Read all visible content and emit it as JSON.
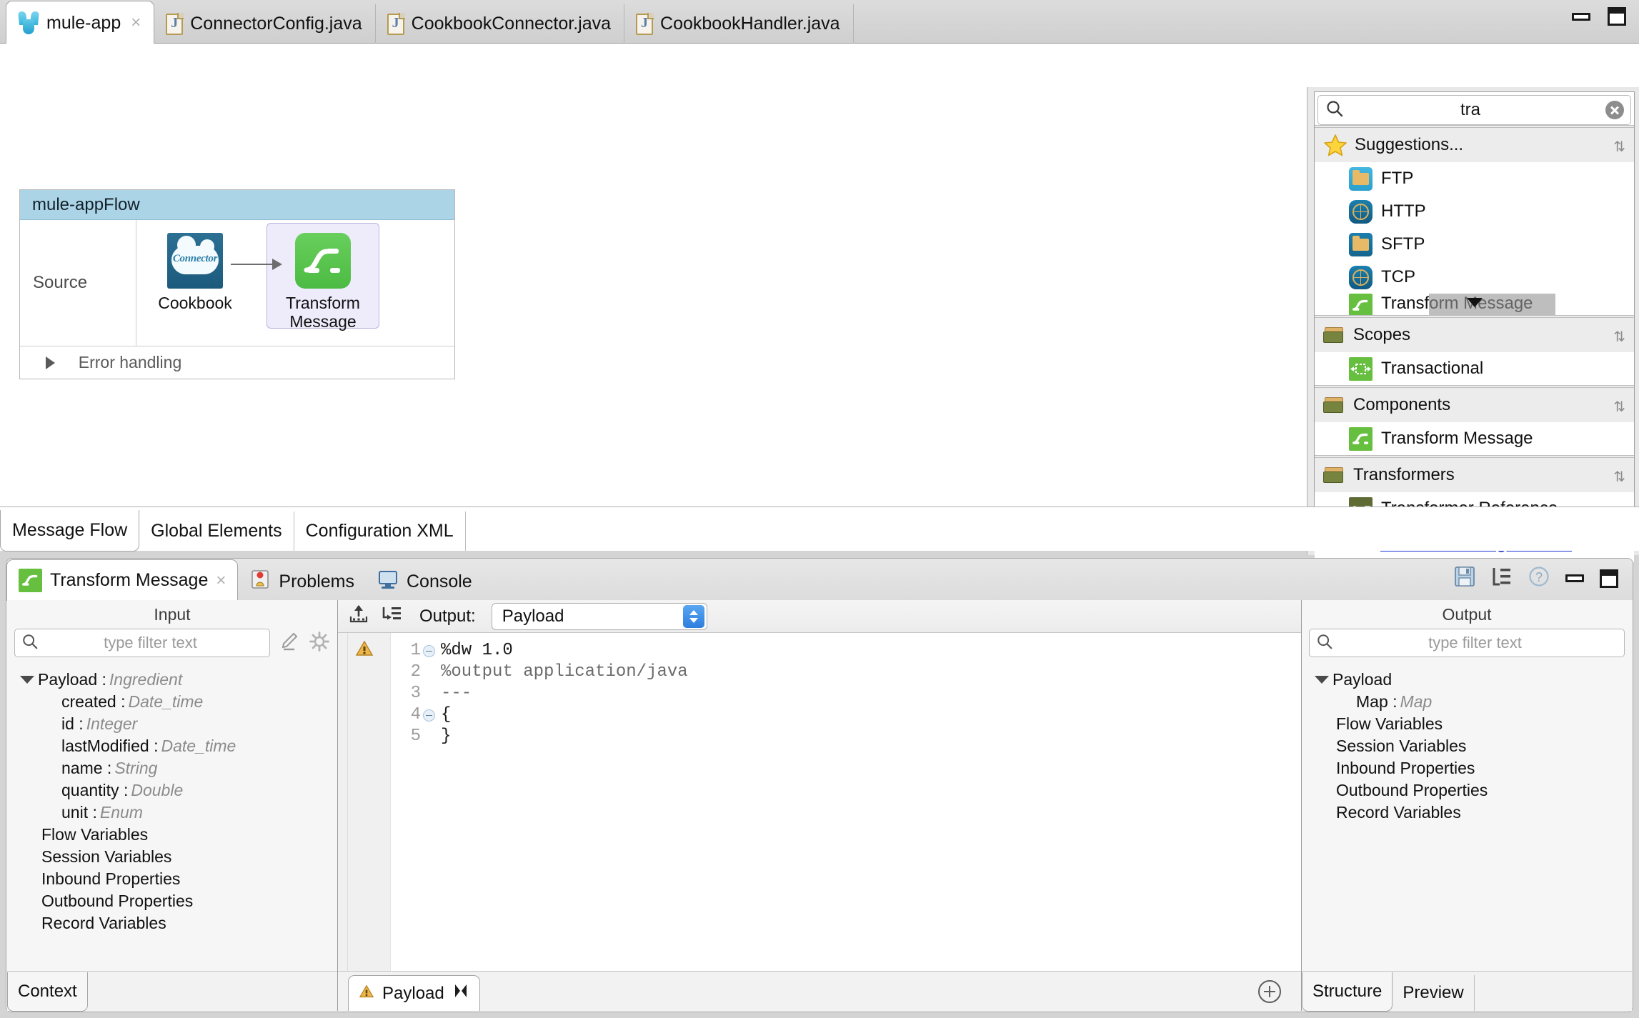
{
  "window": {
    "minimize_label": "Minimize",
    "maximize_label": "Maximize"
  },
  "editor_tabs": [
    {
      "label": "mule-app",
      "icon": "mule-logo-icon",
      "active": true,
      "closable": true,
      "close_label": "×"
    },
    {
      "label": "ConnectorConfig.java",
      "icon": "java-file-icon",
      "active": false,
      "closable": false
    },
    {
      "label": "CookbookConnector.java",
      "icon": "java-file-icon",
      "active": false,
      "closable": false
    },
    {
      "label": "CookbookHandler.java",
      "icon": "java-file-icon",
      "active": false,
      "closable": false
    }
  ],
  "canvas": {
    "flow": {
      "title": "mule-appFlow",
      "source_label": "Source",
      "nodes": [
        {
          "label": "Cookbook",
          "icon": "cookbook-connector-icon",
          "badge": "Connector",
          "selected": false
        },
        {
          "label": "Transform\nMessage",
          "line1": "Transform",
          "line2": "Message",
          "icon": "transform-message-icon",
          "selected": true
        }
      ],
      "error_handling_label": "Error handling"
    }
  },
  "palette": {
    "search": {
      "value": "tra",
      "placeholder": "",
      "clear_label": "Clear"
    },
    "groups": [
      {
        "title": "Suggestions...",
        "icon": "star-icon",
        "items": [
          {
            "label": "FTP",
            "icon": "ftp-icon"
          },
          {
            "label": "HTTP",
            "icon": "http-icon"
          },
          {
            "label": "SFTP",
            "icon": "sftp-icon"
          },
          {
            "label": "TCP",
            "icon": "tcp-icon"
          },
          {
            "label": "Transform Message",
            "icon": "transform-message-icon",
            "clipped": true
          }
        ]
      },
      {
        "title": "Scopes",
        "icon": "folder-icon",
        "items": [
          {
            "label": "Transactional",
            "icon": "transactional-icon"
          }
        ]
      },
      {
        "title": "Components",
        "icon": "folder-icon",
        "items": [
          {
            "label": "Transform Message",
            "icon": "transform-message-icon"
          }
        ]
      },
      {
        "title": "Transformers",
        "icon": "folder-icon",
        "items": [
          {
            "label": "Transformer Reference",
            "icon": "transformer-reference-icon"
          }
        ]
      }
    ],
    "exchange_link": "Search Exchange for 'tra'"
  },
  "canvas_tabs": [
    {
      "label": "Message Flow",
      "active": true
    },
    {
      "label": "Global Elements",
      "active": false
    },
    {
      "label": "Configuration XML",
      "active": false
    }
  ],
  "bottom_panel": {
    "tabs": [
      {
        "label": "Transform Message",
        "icon": "transform-message-icon",
        "active": true,
        "closable": true,
        "close_label": "×"
      },
      {
        "label": "Problems",
        "icon": "problems-icon",
        "active": false
      },
      {
        "label": "Console",
        "icon": "console-icon",
        "active": false
      }
    ],
    "tools": [
      {
        "name": "save-icon",
        "label": "Save"
      },
      {
        "name": "outline-icon",
        "label": "Outline"
      },
      {
        "name": "help-icon",
        "label": "Help"
      },
      {
        "name": "minimize-icon",
        "label": "Minimize"
      },
      {
        "name": "maximize-icon",
        "label": "Maximize"
      }
    ],
    "input": {
      "title": "Input",
      "filter_placeholder": "type filter text",
      "tools": [
        {
          "name": "edit-pencil-icon"
        },
        {
          "name": "gear-icon"
        }
      ],
      "tree": [
        {
          "label": "Payload",
          "type": "Ingredient",
          "expanded": true,
          "indent": 0
        },
        {
          "label": "created",
          "type": "Date_time",
          "indent": 1
        },
        {
          "label": "id",
          "type": "Integer",
          "indent": 1
        },
        {
          "label": "lastModified",
          "type": "Date_time",
          "indent": 1
        },
        {
          "label": "name",
          "type": "String",
          "indent": 1
        },
        {
          "label": "quantity",
          "type": "Double",
          "indent": 1
        },
        {
          "label": "unit",
          "type": "Enum",
          "indent": 1
        },
        {
          "label": "Flow Variables",
          "type": "",
          "indent": 0
        },
        {
          "label": "Session Variables",
          "type": "",
          "indent": 0
        },
        {
          "label": "Inbound Properties",
          "type": "",
          "indent": 0
        },
        {
          "label": "Outbound Properties",
          "type": "",
          "indent": 0
        },
        {
          "label": "Record Variables",
          "type": "",
          "indent": 0
        }
      ],
      "footer_tabs": [
        {
          "label": "Context",
          "active": true
        }
      ]
    },
    "code": {
      "toolbar": {
        "output_label": "Output:",
        "output_value": "Payload",
        "icons": [
          {
            "name": "import-icon"
          },
          {
            "name": "mapping-tree-icon"
          }
        ]
      },
      "gutter_icon": "warning-lock-icon",
      "lines": [
        {
          "num": "1",
          "text": "%dw 1.0",
          "fold": true
        },
        {
          "num": "2",
          "text": "%output application/java",
          "fold": false
        },
        {
          "num": "3",
          "text": "---",
          "fold": false
        },
        {
          "num": "4",
          "text": "{",
          "fold": true
        },
        {
          "num": "5",
          "text": "}",
          "fold": false
        }
      ],
      "footer_tab": {
        "label": "Payload",
        "icon": "warning-icon",
        "close_icon": "close-x-icon"
      },
      "add_button_label": "Add"
    },
    "output": {
      "title": "Output",
      "filter_placeholder": "type filter text",
      "tree": [
        {
          "label": "Payload",
          "type": "",
          "expanded": true,
          "indent": 0
        },
        {
          "label": "Map",
          "type": "Map",
          "indent": 1
        },
        {
          "label": "Flow Variables",
          "type": "",
          "indent": 0
        },
        {
          "label": "Session Variables",
          "type": "",
          "indent": 0
        },
        {
          "label": "Inbound Properties",
          "type": "",
          "indent": 0
        },
        {
          "label": "Outbound Properties",
          "type": "",
          "indent": 0
        },
        {
          "label": "Record Variables",
          "type": "",
          "indent": 0
        }
      ],
      "footer_tabs": [
        {
          "label": "Structure",
          "active": true
        },
        {
          "label": "Preview",
          "active": false
        }
      ]
    }
  },
  "colors": {
    "accent_green": "#54c24a",
    "flow_header_blue": "#abd4e6",
    "selection_lavender": "#eeebfb",
    "link_blue": "#1a33d6"
  }
}
